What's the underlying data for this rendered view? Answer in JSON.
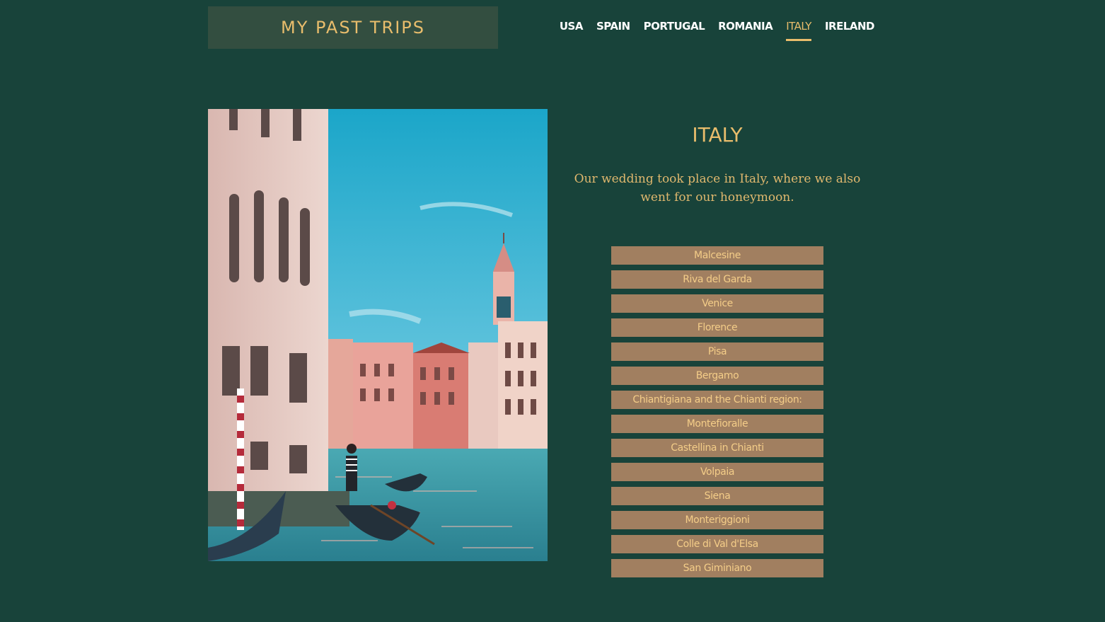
{
  "site_title": "MY PAST TRIPS",
  "nav": [
    "USA",
    "SPAIN",
    "PORTUGAL",
    "ROMANIA",
    "ITALY",
    "IRELAND"
  ],
  "active_nav": "ITALY",
  "main": {
    "heading": "ITALY",
    "description": "Our wedding took place in Italy, where we also went for our honeymoon.",
    "places": [
      "Malcesine",
      "Riva del Garda",
      "Venice",
      "Florence",
      "Pisa",
      "Bergamo",
      "Chiantigiana and the Chianti region:",
      "Montefioralle",
      "Castellina in Chianti",
      "Volpaia",
      "Siena",
      "Monteriggioni",
      "Colle di Val d'Elsa",
      "San Giminiano"
    ]
  },
  "colors": {
    "background": "#18433a",
    "logo_bg": "#334e40",
    "accent": "#e9bd6c",
    "place_bg": "#a17f60"
  }
}
